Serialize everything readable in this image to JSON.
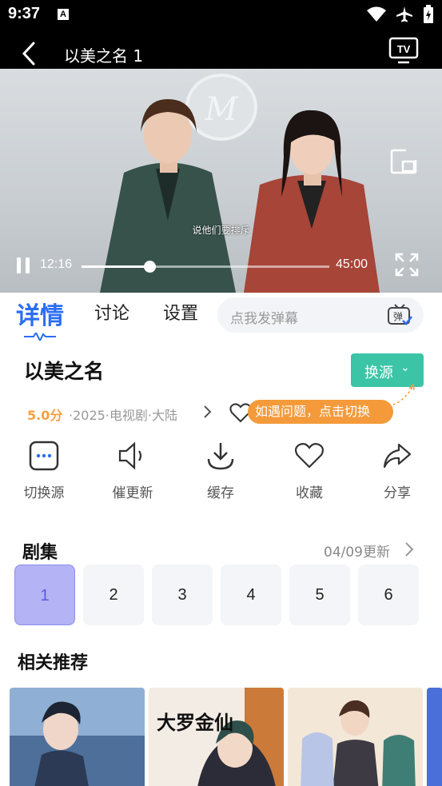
{
  "status": {
    "time": "9:37",
    "a_badge": "A"
  },
  "header": {
    "title": "以美之名 1"
  },
  "player": {
    "subtitle": "说他们要排斥",
    "current_time": "12:16",
    "total_time": "45:00",
    "progress": 0.2726,
    "wall_logo_letter": "M"
  },
  "tabs": {
    "details": "详情",
    "discussion": "讨论",
    "settings": "设置"
  },
  "danmu": {
    "placeholder": "点我发弹幕",
    "icon_text": "弹"
  },
  "show": {
    "name": "以美之名",
    "switch_source_label": "换源",
    "rating": "5.0分",
    "meta": "·2025·电视剧·大陆",
    "tip": "如遇问题，点击切换"
  },
  "actions": [
    {
      "label": "切换源",
      "icon": "more-dots-icon"
    },
    {
      "label": "催更新",
      "icon": "speaker-icon"
    },
    {
      "label": "缓存",
      "icon": "download-icon"
    },
    {
      "label": "收藏",
      "icon": "heart-icon"
    },
    {
      "label": "分享",
      "icon": "share-icon"
    }
  ],
  "episodes": {
    "title": "剧集",
    "update": "04/09更新",
    "items": [
      "1",
      "2",
      "3",
      "4",
      "5",
      "6"
    ],
    "selected": "1"
  },
  "recommend": {
    "title": "相关推荐",
    "cover_text_1": "大罗金仙"
  },
  "colors": {
    "accent": "#2b6ef5",
    "switch_bg": "#3cc4a6",
    "tip_bg": "#f49a3a",
    "rating": "#f3a042",
    "episode_active": "#b3b3f5"
  }
}
